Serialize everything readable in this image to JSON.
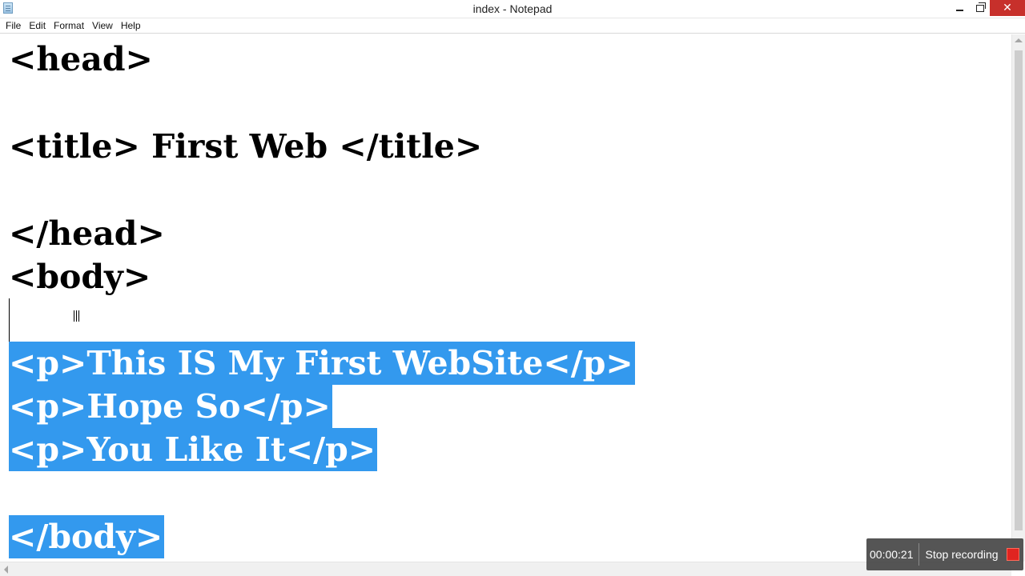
{
  "window": {
    "title": "index - Notepad",
    "controls": {
      "minimize": "minimize",
      "maximize": "restore",
      "close": "✕"
    }
  },
  "menu": [
    "File",
    "Edit",
    "Format",
    "View",
    "Help"
  ],
  "editor": {
    "lines": [
      {
        "text": "<head>",
        "selected": false
      },
      {
        "text": "<title> First Web </title>",
        "selected": false
      },
      {
        "text": "</head>",
        "selected": false
      },
      {
        "text": "<body>",
        "selected": false
      },
      {
        "text": "<p>This IS My First WebSite</p>",
        "selected": true
      },
      {
        "text": "<p>Hope So</p>",
        "selected": true
      },
      {
        "text": "<p>You Like It</p>",
        "selected": true
      },
      {
        "text": "</body>",
        "selected": true
      }
    ],
    "selection_color": "#3399ee"
  },
  "recorder": {
    "time": "00:00:21",
    "stop_label": "Stop recording",
    "stop_color": "#e02420"
  }
}
